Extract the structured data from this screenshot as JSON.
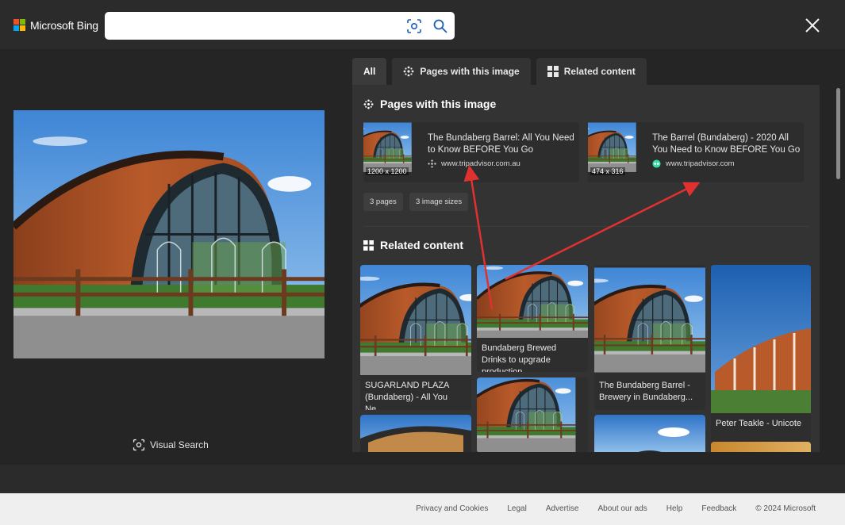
{
  "header": {
    "brand": "Microsoft Bing",
    "search": {
      "value": "",
      "placeholder": ""
    },
    "icons": [
      "visual-search-icon",
      "search-icon",
      "close-icon"
    ]
  },
  "left": {
    "visual_search_label": "Visual Search"
  },
  "tabs": [
    {
      "label": "All",
      "icon": "",
      "active": true
    },
    {
      "label": "Pages with this image",
      "icon": "pages-icon",
      "active": false
    },
    {
      "label": "Related content",
      "icon": "grid-icon",
      "active": false
    }
  ],
  "pages_section": {
    "heading": "Pages with this image",
    "cards": [
      {
        "title": "The Bundaberg Barrel: All You Need to Know BEFORE You Go",
        "source": "www.tripadvisor.com.au",
        "dimensions": "1200 x 1200"
      },
      {
        "title": "The Barrel (Bundaberg) - 2020 All You Need to Know BEFORE You Go",
        "source": "www.tripadvisor.com",
        "dimensions": "474 x 316"
      }
    ],
    "chips": [
      "3 pages",
      "3 image sizes"
    ]
  },
  "related_section": {
    "heading": "Related content",
    "items": [
      {
        "caption": "SUGARLAND PLAZA (Bundaberg) - All You Ne..."
      },
      {
        "caption": "Bundaberg Brewed Drinks to upgrade production..."
      },
      {
        "caption": "The Bundaberg Barrel - Brewery in Bundaberg..."
      },
      {
        "caption": "Peter Teakle - Unicote"
      },
      {
        "caption": ""
      },
      {
        "caption": ""
      },
      {
        "caption": ""
      },
      {
        "caption": ""
      }
    ]
  },
  "footer": {
    "links": [
      "Privacy and Cookies",
      "Legal",
      "Advertise",
      "About our ads",
      "Help",
      "Feedback"
    ],
    "copyright": "© 2024 Microsoft"
  },
  "colors": {
    "background": "#252525",
    "topbar": "#2b2b2b",
    "panel": "#333333",
    "annotation_arrow": "#e03131",
    "footer": "#efefef"
  }
}
